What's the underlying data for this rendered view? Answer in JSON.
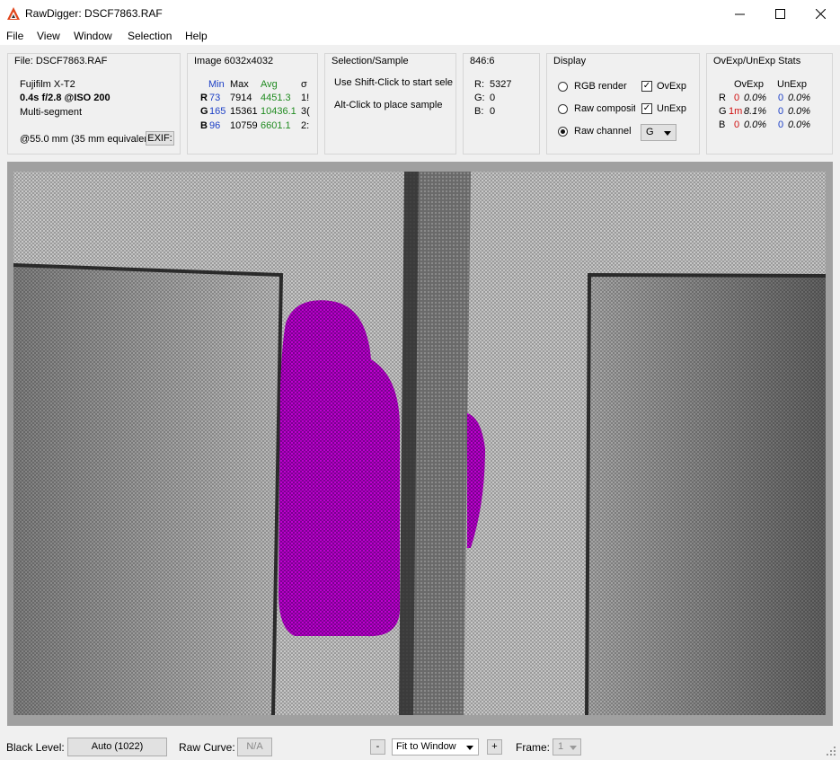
{
  "window": {
    "title": "RawDigger: DSCF7863.RAF",
    "app_icon": "rawdigger-logo-icon"
  },
  "menu": [
    "File",
    "View",
    "Window",
    "Selection",
    "Help"
  ],
  "file_panel": {
    "title": "File: DSCF7863.RAF",
    "camera": "Fujifilm X-T2",
    "exposure": "0.4s f/2.8 @ISO 200",
    "segment": "Multi-segment",
    "focal": "@55.0 mm (35 mm equivalen",
    "exif_button": "EXIF:"
  },
  "image_panel": {
    "title": "Image 6032x4032",
    "headers": {
      "min": "Min",
      "max": "Max",
      "avg": "Avg",
      "sigma": "σ"
    },
    "rows": [
      {
        "ch": "R",
        "min": "73",
        "max": "7914",
        "avg": "4451.3",
        "sigma": "1!"
      },
      {
        "ch": "G",
        "min": "165",
        "max": "15361",
        "avg": "10436.1",
        "sigma": "3("
      },
      {
        "ch": "B",
        "min": "96",
        "max": "10759",
        "avg": "6601.1",
        "sigma": "2:"
      }
    ]
  },
  "selection_panel": {
    "title": "Selection/Sample",
    "line1": "Use Shift-Click to start sele",
    "line2": "Alt-Click to place sample"
  },
  "sample_panel": {
    "title": "846:6",
    "r_label": "R:",
    "r_value": "5327",
    "g_label": "G:",
    "g_value": "0",
    "b_label": "B:",
    "b_value": "0"
  },
  "display_panel": {
    "title": "Display",
    "rgb_render": "RGB render",
    "raw_composite": "Raw composite",
    "raw_channel": "Raw channel",
    "selected_mode": "raw_channel",
    "ovexp_label": "OvExp",
    "ovexp_checked": true,
    "unexp_label": "UnExp",
    "unexp_checked": true,
    "channel_value": "G"
  },
  "stats_panel": {
    "title": "OvExp/UnExp Stats",
    "headers": {
      "ovexp": "OvExp",
      "unexp": "UnExp"
    },
    "rows": [
      {
        "ch": "R",
        "ov_count": "0",
        "ov_pct": "0.0%",
        "un_count": "0",
        "un_pct": "0.0%"
      },
      {
        "ch": "G",
        "ov_count": "1m",
        "ov_pct": "8.1%",
        "un_count": "0",
        "un_pct": "0.0%"
      },
      {
        "ch": "B",
        "ov_count": "0",
        "ov_pct": "0.0%",
        "un_count": "0",
        "un_pct": "0.0%"
      }
    ]
  },
  "statusbar": {
    "black_level_label": "Black Level:",
    "black_level_value": "Auto (1022)",
    "raw_curve_label": "Raw Curve:",
    "raw_curve_value": "N/A",
    "zoom_out": "-",
    "zoom_value": "Fit to Window",
    "zoom_in": "+",
    "frame_label": "Frame:",
    "frame_value": "1"
  },
  "colors": {
    "overexposure": "#b000c0",
    "accent_blue": "#1c3fc6",
    "avg_green": "#208b20",
    "warn_red": "#d01010"
  }
}
